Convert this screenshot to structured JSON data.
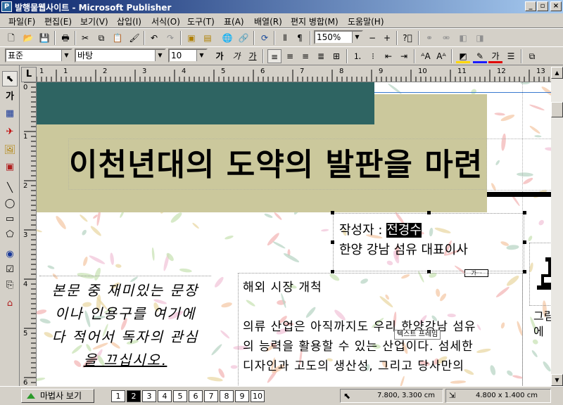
{
  "window": {
    "title": "발행물웹사이트 - Microsoft Publisher",
    "app_icon": "publisher-icon",
    "controls": [
      "_",
      "▫",
      "×"
    ]
  },
  "menu": [
    "파일(F)",
    "편집(E)",
    "보기(V)",
    "삽입(I)",
    "서식(O)",
    "도구(T)",
    "표(A)",
    "배열(R)",
    "편지 병합(M)",
    "도움말(H)"
  ],
  "standard_toolbar": {
    "zoom": "150%"
  },
  "format_toolbar": {
    "style": "표준",
    "font": "바탕",
    "size": "10",
    "char_buttons": [
      "가",
      "가",
      "가"
    ]
  },
  "left_tools": {
    "text_tool": "가"
  },
  "ruler": {
    "corner": "L",
    "h_ticks": [
      "1",
      "1",
      "2",
      "3",
      "4",
      "5",
      "6",
      "7",
      "8",
      "9",
      "10",
      "11",
      "12",
      "13"
    ],
    "v_ticks": [
      "0",
      "1",
      "2",
      "3",
      "4",
      "5",
      "6"
    ]
  },
  "document": {
    "headline": "이천년대의 도약의 발판을 마련",
    "author_label": "작성자 : ",
    "author_name": "전경수",
    "author_title": "한양 강남 섬유 대표이사",
    "overflow_indicator": "가···",
    "frame_tooltip": "텍스트 프레임",
    "body_heading": "해외 시장 개척",
    "body_lines": [
      "의류 산업은 아직까지도 우리 한양강남 섬유",
      "의 능력을 활용할 수 있는 산업이다. 섬세한",
      "디자인과 고도의 생산성, 그리고 당사만의"
    ],
    "quote_lines": [
      "본문 중 재미있는 문장",
      "이나 인용구를 여기에",
      "다 적어서 독자의 관심",
      "을 끄십시오."
    ],
    "side_lines": [
      "그림",
      "에"
    ]
  },
  "status": {
    "wizard_label": "마법사 보기",
    "pages": [
      "1",
      "2",
      "3",
      "4",
      "5",
      "6",
      "7",
      "8",
      "9",
      "10"
    ],
    "active_page": "2",
    "position": "7.800, 3.300 cm",
    "size": "4.800 x 1.400 cm"
  },
  "colors": {
    "title_band": "#cbc89c",
    "top_band": "#2e6462",
    "titlebar_start": "#0a246a",
    "titlebar_end": "#a6caf0"
  }
}
